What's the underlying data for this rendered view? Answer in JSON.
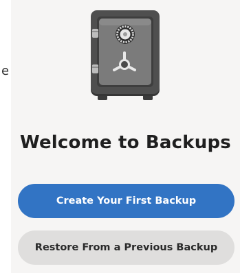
{
  "edge_fragment": "e",
  "welcome": {
    "title": "Welcome to Backups"
  },
  "actions": {
    "primary_label": "Create Your First Backup",
    "secondary_label": "Restore From a Previous Backup"
  },
  "icon": {
    "name": "safe-icon"
  },
  "colors": {
    "panel_background": "#f6f5f4",
    "primary_button": "#3274c4",
    "secondary_button": "#dfdedd",
    "title_text": "#1f1f1f"
  }
}
